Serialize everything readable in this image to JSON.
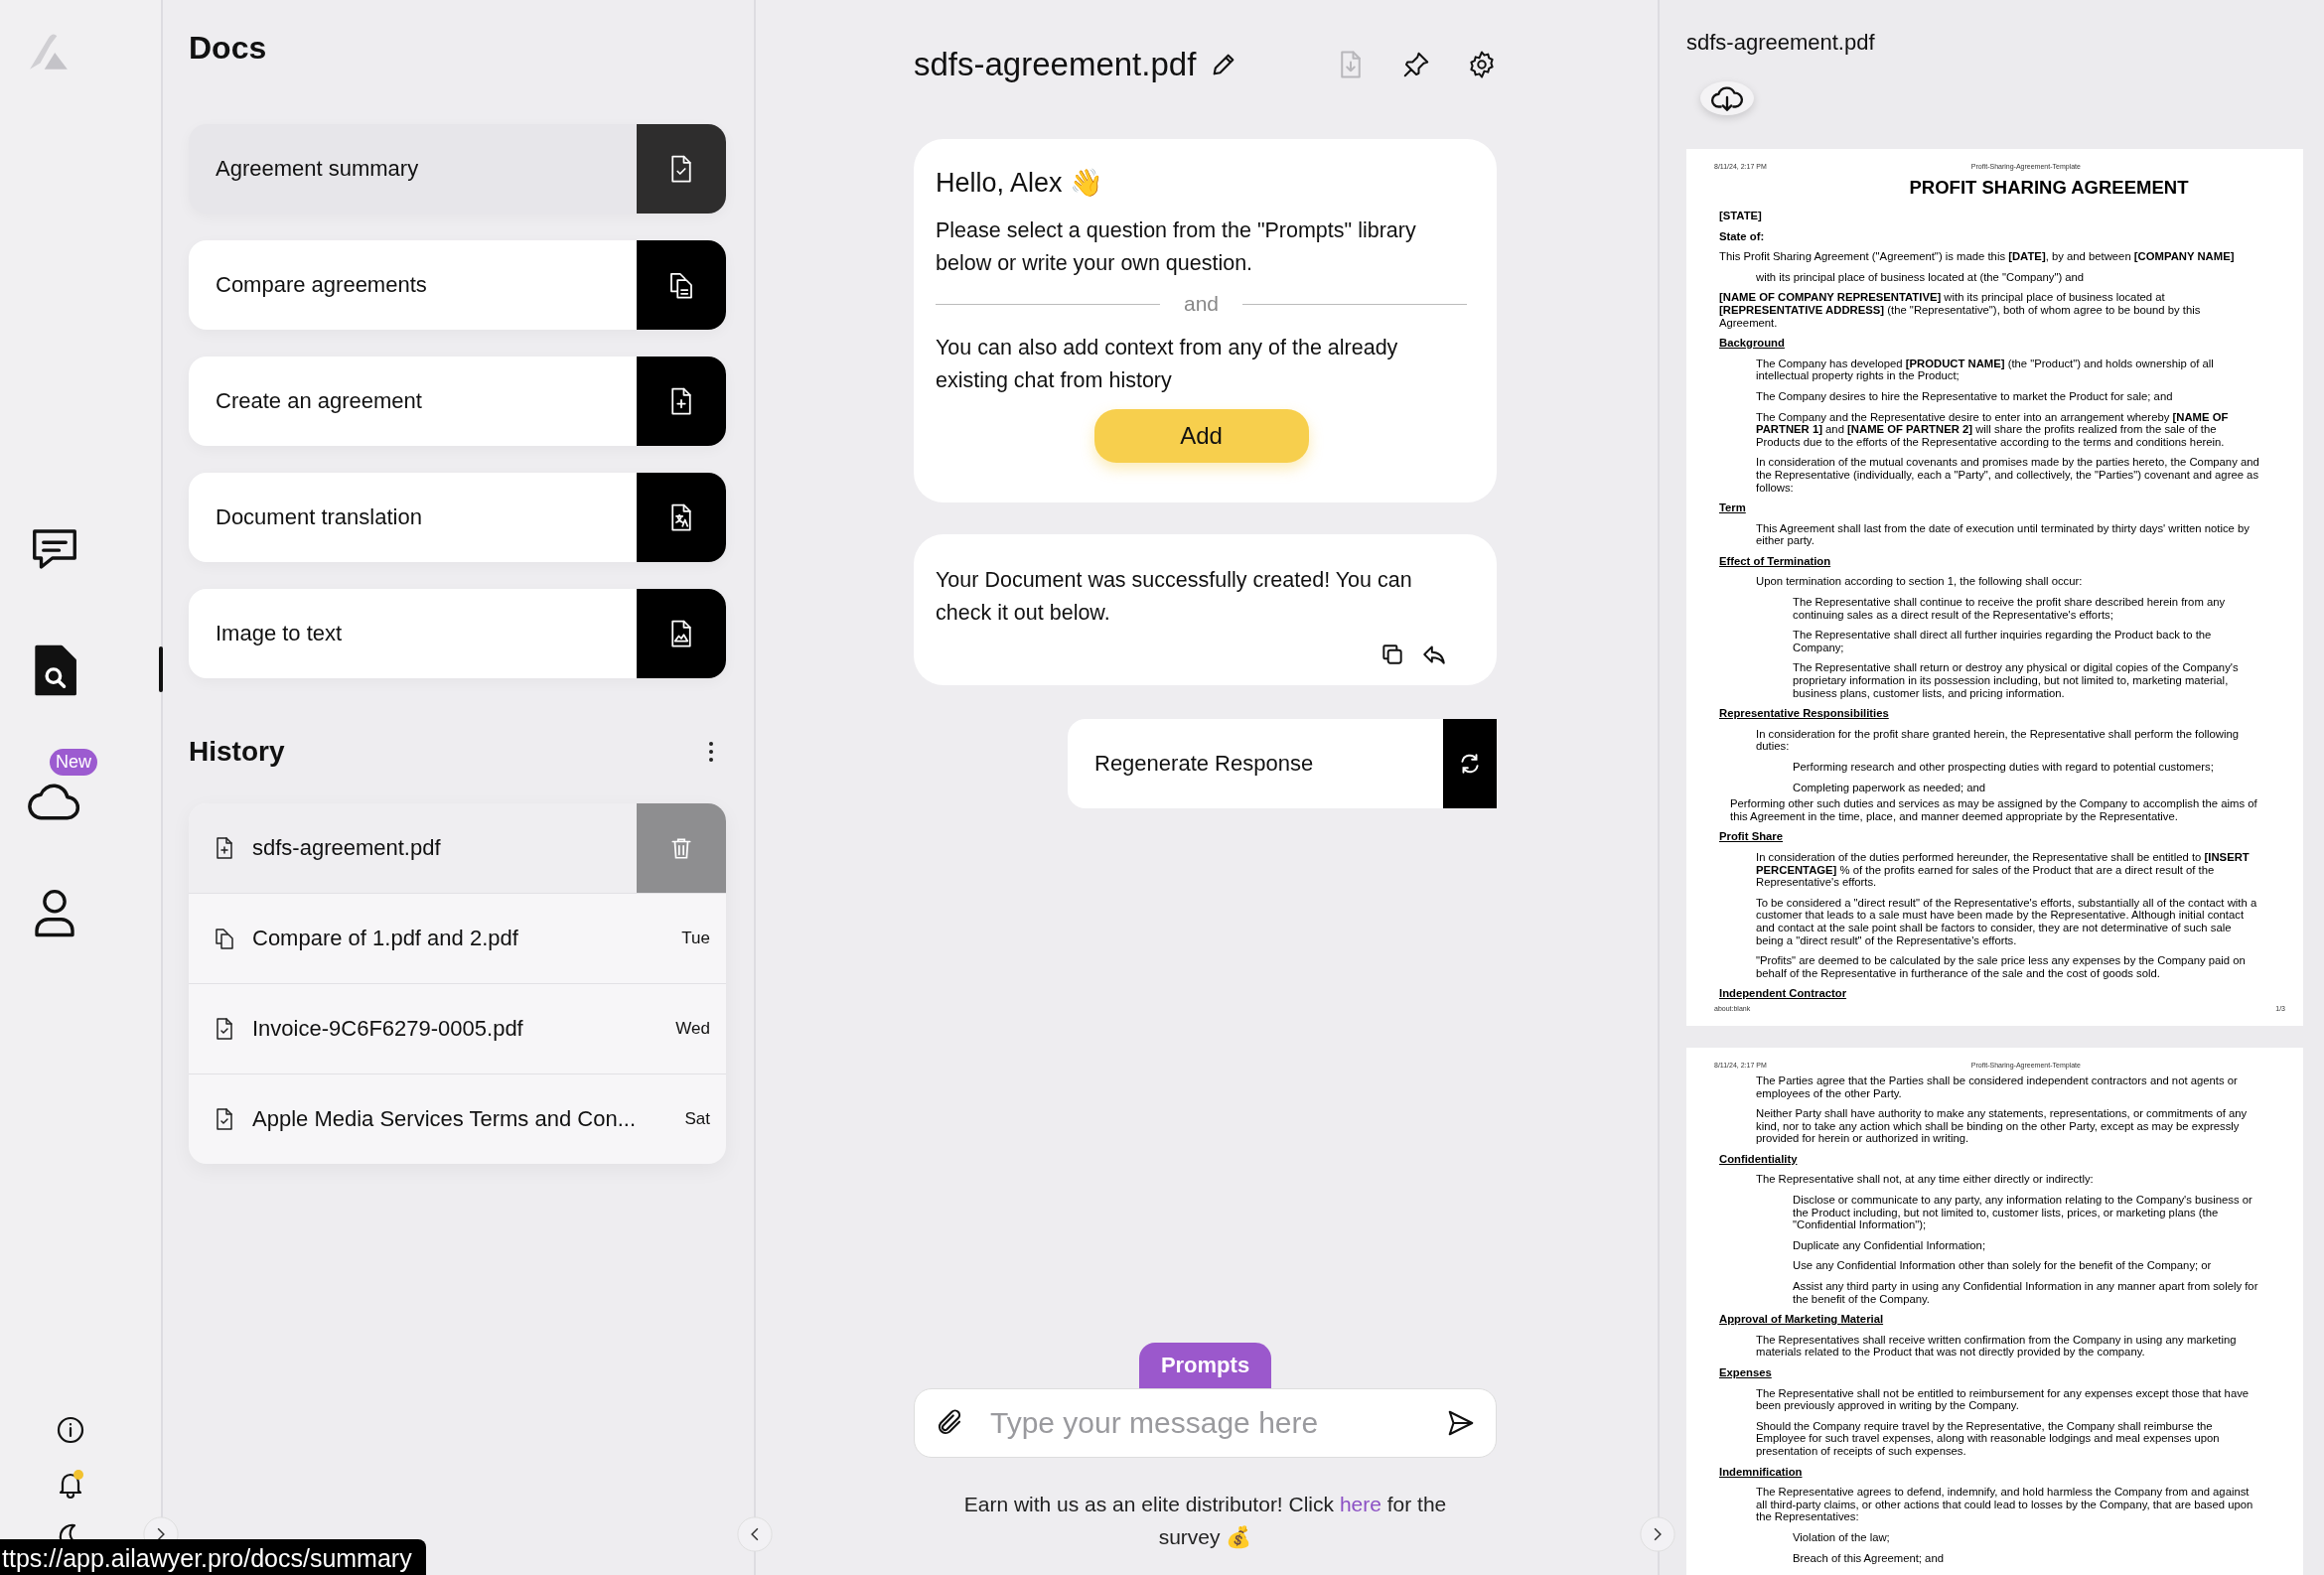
{
  "rail": {
    "items": [
      {
        "kind": "chat",
        "selected": false
      },
      {
        "kind": "doc-search",
        "selected": true
      },
      {
        "kind": "cloud",
        "selected": false,
        "badge": "New"
      },
      {
        "kind": "user",
        "selected": false
      }
    ],
    "bottom": [
      {
        "kind": "info",
        "alert": false
      },
      {
        "kind": "bell",
        "alert": true
      },
      {
        "kind": "moon",
        "alert": false
      }
    ]
  },
  "docs": {
    "title": "Docs",
    "tools": [
      {
        "label": "Agreement summary",
        "kind": "check",
        "selected": true
      },
      {
        "label": "Compare agreements",
        "kind": "compare",
        "selected": false
      },
      {
        "label": "Create an agreement",
        "kind": "add",
        "selected": false
      },
      {
        "label": "Document translation",
        "kind": "translate",
        "selected": false
      },
      {
        "label": "Image to text",
        "kind": "image",
        "selected": false
      }
    ]
  },
  "history": {
    "title": "History",
    "items": [
      {
        "name": "sdfs-agreement.pdf",
        "kind": "add",
        "selected": true
      },
      {
        "name": "Compare of 1.pdf and 2.pdf",
        "kind": "compare",
        "day": "Tue",
        "selected": false
      },
      {
        "name": "Invoice-9C6F6279-0005.pdf",
        "kind": "check",
        "day": "Wed",
        "selected": false
      },
      {
        "name": "Apple Media Services Terms and Con...",
        "kind": "check",
        "day": "Sat",
        "selected": false
      }
    ]
  },
  "chat": {
    "title": "sdfs-agreement.pdf",
    "toolbar": [
      {
        "kind": "download",
        "disabled": true
      },
      {
        "kind": "pin",
        "disabled": false
      },
      {
        "kind": "settings",
        "disabled": false
      }
    ],
    "messages": [
      {
        "kind": "welcome",
        "greeting": "Hello, Alex 👋",
        "text": "Please select a question from the \"Prompts\" library below or write your own question.",
        "divider": "and",
        "context": "You can also add context from any of the already existing chat from history",
        "button": "Add"
      },
      {
        "kind": "result",
        "text": "Your Document was successfully created! You can check it out below."
      }
    ],
    "regenerate": "Regenerate Response",
    "prompts_tab": "Prompts",
    "input": {
      "placeholder": "Type your message here"
    },
    "promo": {
      "before": "Earn with us as an elite distributor! Click",
      "link": "here",
      "after": "for the survey 💰"
    }
  },
  "viewer": {
    "title": "sdfs-agreement.pdf",
    "pages": [
      {
        "date": "8/11/24, 2:17 PM",
        "name": "Profit-Sharing-Agreement-Template",
        "footer_left": "about:blank",
        "footer_right": "1/3",
        "blocks": [
          {
            "kind": "title",
            "text": "PROFIT SHARING AGREEMENT"
          },
          {
            "kind": "label",
            "text": "[STATE]"
          },
          {
            "kind": "label",
            "text": "State of:"
          },
          {
            "kind": "text",
            "text": "This Profit Sharing Agreement (\"Agreement\") is made this **[DATE]**, by and between **[COMPANY NAME]**"
          },
          {
            "kind": "para",
            "text": "with its principal place of business located at (the \"Company\") and"
          },
          {
            "kind": "text",
            "text": "**[NAME OF COMPANY REPRESENTATIVE]** with its principal place of business located at **[REPRESENTATIVE ADDRESS]** (the \"Representative\"), both of whom agree to be bound by this Agreement."
          },
          {
            "kind": "heading",
            "text": "Background"
          },
          {
            "kind": "para",
            "text": "The Company has developed **[PRODUCT NAME]** (the \"Product\") and holds ownership of all intellectual property rights in the Product;"
          },
          {
            "kind": "para",
            "text": "The Company desires to hire the Representative to market the Product for sale; and"
          },
          {
            "kind": "para",
            "text": "The Company and the Representative desire to enter into an arrangement whereby **[NAME OF PARTNER 1]** and **[NAME OF PARTNER 2]** will share the profits realized from the sale of the Products due to the efforts of the Representative according to the terms and conditions herein."
          },
          {
            "kind": "para",
            "text": "In consideration of the mutual covenants and promises made by the parties hereto, the Company and the Representative (individually, each a \"Party\", and collectively, the \"Parties\") covenant and agree as follows:"
          },
          {
            "kind": "heading",
            "text": "Term"
          },
          {
            "kind": "para",
            "text": "This Agreement shall last from the date of execution until terminated by thirty days' written notice by either party."
          },
          {
            "kind": "heading",
            "text": "Effect of Termination"
          },
          {
            "kind": "para",
            "text": "Upon termination according to section 1, the following shall occur:"
          },
          {
            "kind": "item",
            "text": "The Representative shall continue to receive the profit share described herein from any continuing sales as a direct result of the Representative's efforts;"
          },
          {
            "kind": "item",
            "text": "The Representative shall direct all further inquiries regarding the Product back to the Company;"
          },
          {
            "kind": "item",
            "text": "The Representative shall return or destroy any physical or digital copies of the Company's proprietary information in its possession including, but not limited to, marketing material, business plans, customer lists, and pricing information."
          },
          {
            "kind": "heading",
            "text": "Representative Responsibilities"
          },
          {
            "kind": "para",
            "text": "In consideration for the profit share granted herein, the Representative shall perform the following duties:"
          },
          {
            "kind": "item",
            "text": "Performing research and other prospecting duties with regard to potential customers;"
          },
          {
            "kind": "item",
            "text": "Completing paperwork as needed; and"
          },
          {
            "kind": "aside",
            "text": "Performing other such duties and services as may be assigned by the Company to accomplish the aims of this Agreement in the time, place, and manner deemed appropriate by the Representative."
          },
          {
            "kind": "heading",
            "text": "Profit Share"
          },
          {
            "kind": "para",
            "text": "In consideration of the duties performed hereunder, the Representative shall be entitled to **[INSERT PERCENTAGE]** % of the profits earned for sales of the Product that are a direct result of the Representative's efforts."
          },
          {
            "kind": "para",
            "text": "To be considered a \"direct result\" of the Representative's efforts, substantially all of the contact with a customer that leads to a sale must have been made by the Representative. Although initial contact and contact at the sale point shall be factors to consider, they are not determinative of such sale being a \"direct result\" of the Representative's efforts."
          },
          {
            "kind": "para",
            "text": "\"Profits\" are deemed to be calculated by the sale price less any expenses by the Company paid on behalf of the Representative in furtherance of the sale and the cost of goods sold."
          },
          {
            "kind": "heading",
            "text": "Independent Contractor"
          }
        ]
      },
      {
        "date": "8/11/24, 2:17 PM",
        "name": "Profit-Sharing-Agreement-Template",
        "blocks": [
          {
            "kind": "para",
            "text": "The Parties agree that the Parties shall be considered independent contractors and not agents or employees of the other Party."
          },
          {
            "kind": "para",
            "text": "Neither Party shall have authority to make any statements, representations, or commitments of any kind, nor to take any action which shall be binding on the other Party, except as may be expressly provided for herein or authorized in writing."
          },
          {
            "kind": "heading",
            "text": "Confidentiality"
          },
          {
            "kind": "para",
            "text": "The Representative shall not, at any time either directly or indirectly:"
          },
          {
            "kind": "item",
            "text": "Disclose or communicate to any party, any information relating to the Company's business or the Product including, but not limited to, customer lists, prices, or marketing plans (the \"Confidential Information\");"
          },
          {
            "kind": "item",
            "text": "Duplicate any Confidential Information;"
          },
          {
            "kind": "item",
            "text": "Use any Confidential Information other than solely for the benefit of the Company; or"
          },
          {
            "kind": "item",
            "text": "Assist any third party in using any Confidential Information in any manner apart from solely for the benefit of the Company."
          },
          {
            "kind": "heading",
            "text": "Approval of Marketing Material"
          },
          {
            "kind": "para",
            "text": "The Representatives shall receive written confirmation from the Company in using any marketing materials related to the Product that was not directly provided by the company."
          },
          {
            "kind": "heading",
            "text": "Expenses"
          },
          {
            "kind": "para",
            "text": "The Representative shall not be entitled to reimbursement for any expenses except those that have been previously approved in writing by the Company."
          },
          {
            "kind": "para",
            "text": "Should the Company require travel by the Representative, the Company shall reimburse the Employee for such travel expenses, along with reasonable lodgings and meal expenses upon presentation of receipts of such expenses."
          },
          {
            "kind": "heading",
            "text": "Indemnification"
          },
          {
            "kind": "para",
            "text": "The Representative agrees to defend, indemnify, and hold harmless the Company from and against all third-party claims, or other actions that could lead to losses by the Company, that are based upon the Representatives:"
          },
          {
            "kind": "item",
            "text": "Violation of the law;"
          },
          {
            "kind": "item",
            "text": "Breach of this Agreement; and"
          }
        ]
      }
    ]
  },
  "tooltip": "ttps://app.ailawyer.pro/docs/summary"
}
